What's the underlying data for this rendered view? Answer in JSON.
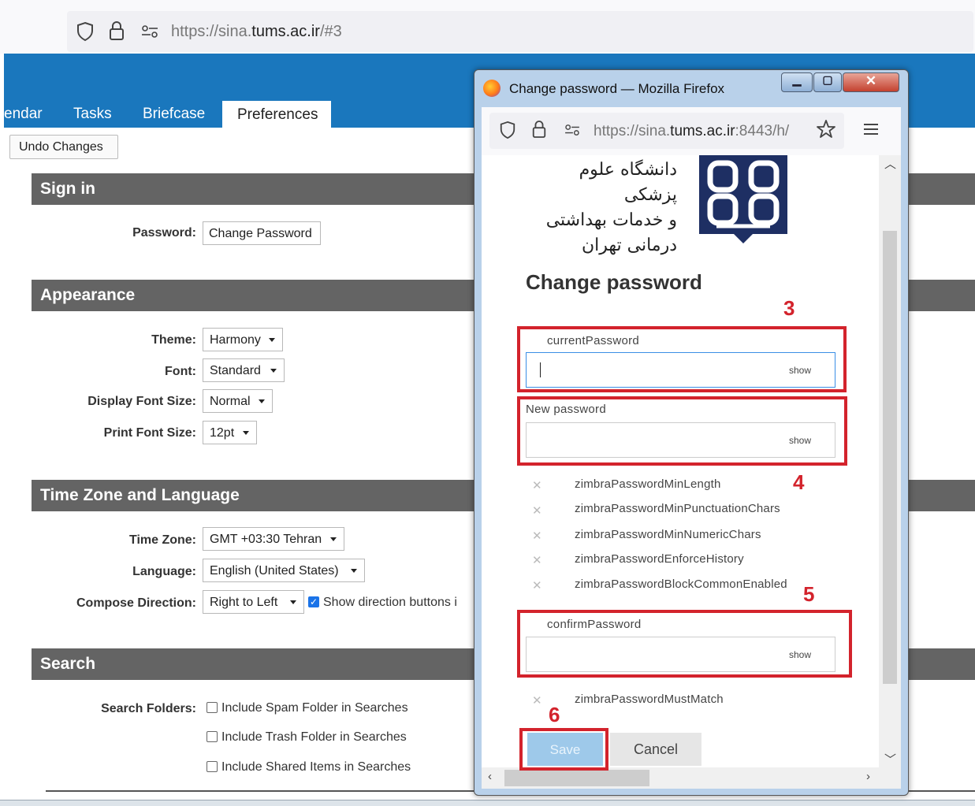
{
  "browser": {
    "url_prefix": "https://sina.",
    "url_domain": "tums.ac.ir",
    "url_suffix": "/#3"
  },
  "app": {
    "tabs": [
      "endar",
      "Tasks",
      "Briefcase"
    ],
    "active_tab": "Preferences",
    "undo_button": "Undo Changes"
  },
  "sections": {
    "sign_in": "Sign in",
    "appearance": "Appearance",
    "timezone": "Time Zone and Language",
    "search": "Search"
  },
  "sign_in": {
    "password_label": "Password:",
    "change_password_button": "Change Password"
  },
  "appearance": {
    "theme_label": "Theme:",
    "theme_value": "Harmony",
    "font_label": "Font:",
    "font_value": "Standard",
    "display_font_size_label": "Display Font Size:",
    "display_font_size_value": "Normal",
    "print_font_size_label": "Print Font Size:",
    "print_font_size_value": "12pt"
  },
  "timezone": {
    "time_zone_label": "Time Zone:",
    "time_zone_value": "GMT +03:30 Tehran",
    "language_label": "Language:",
    "language_value": "English (United States)",
    "compose_direction_label": "Compose Direction:",
    "compose_direction_value": "Right to Left",
    "show_direction_buttons_text": "Show direction buttons i",
    "show_direction_buttons_checked": true
  },
  "search": {
    "search_folders_label": "Search Folders:",
    "options": [
      "Include Spam Folder in Searches",
      "Include Trash Folder in Searches",
      "Include Shared Items in Searches"
    ]
  },
  "popup": {
    "window_title": "Change password — Mozilla Firefox",
    "url_prefix": "https://sina.",
    "url_domain": "tums.ac.ir",
    "url_suffix": ":8443/h/",
    "university_name_line1": "دانشگاه علوم پزشکی",
    "university_name_line2": "و خدمات بهداشتی درمانی تهران",
    "heading": "Change password",
    "current_password_label": "currentPassword",
    "new_password_label": "New password",
    "confirm_password_label": "confirmPassword",
    "show_label": "show",
    "rules": [
      "zimbraPasswordMinLength",
      "zimbraPasswordMinPunctuationChars",
      "zimbraPasswordMinNumericChars",
      "zimbraPasswordEnforceHistory",
      "zimbraPasswordBlockCommonEnabled"
    ],
    "match_rule": "zimbraPasswordMustMatch",
    "rule_mark": "✕",
    "save_button": "Save",
    "cancel_button": "Cancel"
  },
  "annotations": [
    "3",
    "4",
    "5",
    "6"
  ],
  "colors": {
    "app_blue": "#1a77bd",
    "section_gray": "#646464",
    "annotation_red": "#d3232c",
    "save_blue": "#9ec9ea"
  }
}
